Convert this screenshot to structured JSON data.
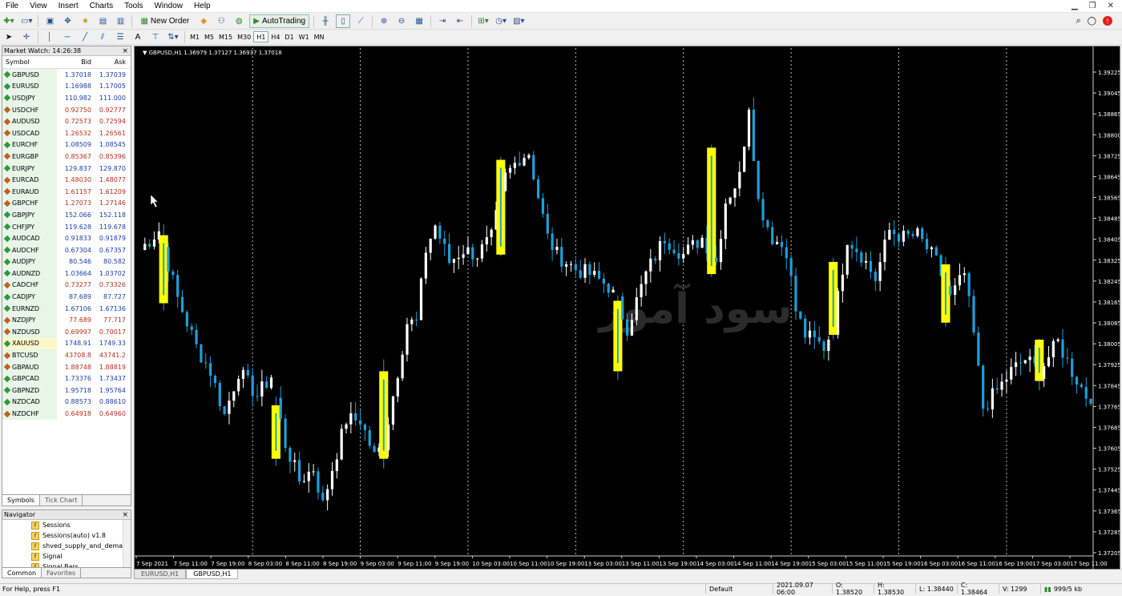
{
  "menu": [
    "File",
    "View",
    "Insert",
    "Charts",
    "Tools",
    "Window",
    "Help"
  ],
  "toolbar": {
    "new_order": "New Order",
    "auto_trading": "AutoTrading"
  },
  "timeframes": [
    "M1",
    "M5",
    "M15",
    "M30",
    "H1",
    "H4",
    "D1",
    "W1",
    "MN"
  ],
  "active_timeframe": "H1",
  "market_watch": {
    "title": "Market Watch: 14:26:38",
    "headers": {
      "symbol": "Symbol",
      "bid": "Bid",
      "ask": "Ask"
    },
    "rows": [
      {
        "symbol": "GBPUSD",
        "bid": "1.37018",
        "ask": "1.37039",
        "dir": "up"
      },
      {
        "symbol": "EURUSD",
        "bid": "1.16988",
        "ask": "1.17005",
        "dir": "up"
      },
      {
        "symbol": "USDJPY",
        "bid": "110.982",
        "ask": "111.000",
        "dir": "up"
      },
      {
        "symbol": "USDCHF",
        "bid": "0.92750",
        "ask": "0.92777",
        "dir": "dn"
      },
      {
        "symbol": "AUDUSD",
        "bid": "0.72573",
        "ask": "0.72594",
        "dir": "dn"
      },
      {
        "symbol": "USDCAD",
        "bid": "1.26532",
        "ask": "1.26561",
        "dir": "dn"
      },
      {
        "symbol": "EURCHF",
        "bid": "1.08509",
        "ask": "1.08545",
        "dir": "up"
      },
      {
        "symbol": "EURGBP",
        "bid": "0.85367",
        "ask": "0.85396",
        "dir": "dn"
      },
      {
        "symbol": "EURJPY",
        "bid": "129.837",
        "ask": "129.870",
        "dir": "up"
      },
      {
        "symbol": "EURCAD",
        "bid": "1.48030",
        "ask": "1.48077",
        "dir": "dn"
      },
      {
        "symbol": "EURAUD",
        "bid": "1.61157",
        "ask": "1.61209",
        "dir": "dn"
      },
      {
        "symbol": "GBPCHF",
        "bid": "1.27073",
        "ask": "1.27146",
        "dir": "dn"
      },
      {
        "symbol": "GBPJPY",
        "bid": "152.066",
        "ask": "152.118",
        "dir": "up"
      },
      {
        "symbol": "CHFJPY",
        "bid": "119.628",
        "ask": "119.678",
        "dir": "up"
      },
      {
        "symbol": "AUDCAD",
        "bid": "0.91833",
        "ask": "0.91879",
        "dir": "up"
      },
      {
        "symbol": "AUDCHF",
        "bid": "0.67304",
        "ask": "0.67357",
        "dir": "up"
      },
      {
        "symbol": "AUDJPY",
        "bid": "80.546",
        "ask": "80.582",
        "dir": "up"
      },
      {
        "symbol": "AUDNZD",
        "bid": "1.03664",
        "ask": "1.03702",
        "dir": "up"
      },
      {
        "symbol": "CADCHF",
        "bid": "0.73277",
        "ask": "0.73326",
        "dir": "dn"
      },
      {
        "symbol": "CADJPY",
        "bid": "87.689",
        "ask": "87.727",
        "dir": "up"
      },
      {
        "symbol": "EURNZD",
        "bid": "1.67106",
        "ask": "1.67136",
        "dir": "up"
      },
      {
        "symbol": "NZDJPY",
        "bid": "77.689",
        "ask": "77.717",
        "dir": "dn"
      },
      {
        "symbol": "NZDUSD",
        "bid": "0.69997",
        "ask": "0.70017",
        "dir": "dn"
      },
      {
        "symbol": "XAUUSD",
        "bid": "1748.91",
        "ask": "1749.33",
        "dir": "up",
        "selected": true
      },
      {
        "symbol": "BTCUSD",
        "bid": "43708.8",
        "ask": "43741.2",
        "dir": "dn"
      },
      {
        "symbol": "GBPAUD",
        "bid": "1.88748",
        "ask": "1.88819",
        "dir": "dn"
      },
      {
        "symbol": "GBPCAD",
        "bid": "1.73376",
        "ask": "1.73437",
        "dir": "up"
      },
      {
        "symbol": "GBPNZD",
        "bid": "1.95718",
        "ask": "1.95764",
        "dir": "up"
      },
      {
        "symbol": "NZDCAD",
        "bid": "0.88573",
        "ask": "0.88610",
        "dir": "up"
      },
      {
        "symbol": "NZDCHF",
        "bid": "0.64918",
        "ask": "0.64960",
        "dir": "dn"
      }
    ],
    "tabs": [
      "Symbols",
      "Tick Chart"
    ]
  },
  "navigator": {
    "title": "Navigator",
    "items": [
      "Sessions",
      "Sessions(auto) v1.8",
      "shved_supply_and_dema",
      "Signal",
      "Signal Bars"
    ],
    "tabs": [
      "Common",
      "Favorites"
    ]
  },
  "chart": {
    "header": "GBPUSD,H1  1.36979 1.37127 1.36937 1.37018",
    "tabs": [
      "EURUSD,H1",
      "GBPUSD,H1"
    ],
    "active_tab": "GBPUSD,H1"
  },
  "chart_data": {
    "type": "candlestick",
    "symbol": "GBPUSD",
    "timeframe": "H1",
    "ylim": [
      1.3714,
      1.3923
    ],
    "yticks": [
      "1.39225",
      "1.39045",
      "1.38865",
      "1.38800",
      "1.38725",
      "1.38645",
      "1.38565",
      "1.38485",
      "1.38405",
      "1.38325",
      "1.38245",
      "1.38165",
      "1.38085",
      "1.38005",
      "1.37925",
      "1.37845",
      "1.37765",
      "1.37685",
      "1.37605",
      "1.37525",
      "1.37445",
      "1.37365",
      "1.37285",
      "1.37205"
    ],
    "xticks": [
      "7 Sep 2021",
      "7 Sep 11:00",
      "7 Sep 19:00",
      "8 Sep 03:00",
      "8 Sep 11:00",
      "8 Sep 19:00",
      "9 Sep 03:00",
      "9 Sep 11:00",
      "9 Sep 19:00",
      "10 Sep 03:00",
      "10 Sep 11:00",
      "10 Sep 19:00",
      "13 Sep 03:00",
      "13 Sep 11:00",
      "13 Sep 19:00",
      "14 Sep 03:00",
      "14 Sep 11:00",
      "14 Sep 19:00",
      "15 Sep 03:00",
      "15 Sep 11:00",
      "15 Sep 19:00",
      "16 Sep 03:00",
      "16 Sep 11:00",
      "16 Sep 19:00",
      "17 Sep 03:00",
      "17 Sep 11:00"
    ],
    "bull_color": "#ffffff",
    "bear_color": "#1e9fd8",
    "highlight_color": "#ffff00",
    "background": "#000000",
    "watermark": "سود آموز",
    "highlights": [
      {
        "t": 5,
        "o": 1.3846,
        "c": 1.3818
      },
      {
        "t": 29,
        "o": 1.3776,
        "c": 1.3754
      },
      {
        "t": 52,
        "o": 1.3754,
        "c": 1.379
      },
      {
        "t": 77,
        "o": 1.3838,
        "c": 1.3877
      },
      {
        "t": 102,
        "o": 1.3819,
        "c": 1.379
      },
      {
        "t": 122,
        "o": 1.383,
        "c": 1.3882
      },
      {
        "t": 148,
        "o": 1.3805,
        "c": 1.3835
      },
      {
        "t": 172,
        "o": 1.3834,
        "c": 1.381
      },
      {
        "t": 192,
        "o": 1.3786,
        "c": 1.3803
      }
    ],
    "anchors": [
      [
        0,
        1.384
      ],
      [
        4,
        1.3848
      ],
      [
        8,
        1.382
      ],
      [
        12,
        1.38
      ],
      [
        15,
        1.379
      ],
      [
        18,
        1.3772
      ],
      [
        21,
        1.379
      ],
      [
        25,
        1.378
      ],
      [
        28,
        1.3788
      ],
      [
        31,
        1.376
      ],
      [
        34,
        1.3745
      ],
      [
        37,
        1.375
      ],
      [
        39,
        1.3735
      ],
      [
        41,
        1.375
      ],
      [
        44,
        1.377
      ],
      [
        47,
        1.377
      ],
      [
        50,
        1.3755
      ],
      [
        52,
        1.376
      ],
      [
        55,
        1.379
      ],
      [
        57,
        1.381
      ],
      [
        59,
        1.381
      ],
      [
        61,
        1.384
      ],
      [
        63,
        1.385
      ],
      [
        66,
        1.3835
      ],
      [
        69,
        1.384
      ],
      [
        72,
        1.3838
      ],
      [
        75,
        1.3845
      ],
      [
        78,
        1.387
      ],
      [
        81,
        1.3878
      ],
      [
        83,
        1.388
      ],
      [
        85,
        1.3862
      ],
      [
        87,
        1.3845
      ],
      [
        89,
        1.3838
      ],
      [
        93,
        1.3832
      ],
      [
        96,
        1.383
      ],
      [
        100,
        1.3825
      ],
      [
        102,
        1.3818
      ],
      [
        104,
        1.3808
      ],
      [
        108,
        1.383
      ],
      [
        112,
        1.3845
      ],
      [
        116,
        1.3838
      ],
      [
        120,
        1.3845
      ],
      [
        123,
        1.3835
      ],
      [
        125,
        1.386
      ],
      [
        128,
        1.387
      ],
      [
        130,
        1.39
      ],
      [
        132,
        1.386
      ],
      [
        135,
        1.3845
      ],
      [
        138,
        1.384
      ],
      [
        140,
        1.3815
      ],
      [
        142,
        1.3805
      ],
      [
        146,
        1.38
      ],
      [
        148,
        1.3808
      ],
      [
        151,
        1.3845
      ],
      [
        154,
        1.3838
      ],
      [
        157,
        1.3828
      ],
      [
        160,
        1.3848
      ],
      [
        163,
        1.3845
      ],
      [
        166,
        1.3846
      ],
      [
        170,
        1.3835
      ],
      [
        173,
        1.382
      ],
      [
        176,
        1.383
      ],
      [
        178,
        1.3805
      ],
      [
        180,
        1.3775
      ],
      [
        183,
        1.3782
      ],
      [
        186,
        1.379
      ],
      [
        189,
        1.3795
      ],
      [
        192,
        1.379
      ],
      [
        196,
        1.3802
      ],
      [
        199,
        1.379
      ],
      [
        202,
        1.378
      ]
    ]
  },
  "status": {
    "help": "For Help, press F1",
    "profile": "Default",
    "datetime": "2021.09.07 06:00",
    "open": "O: 1.38520",
    "high": "H: 1.38530",
    "low": "L: 1.38440",
    "close": "C: 1.38464",
    "volume": "V: 1299",
    "traffic": "999/5 kb"
  }
}
